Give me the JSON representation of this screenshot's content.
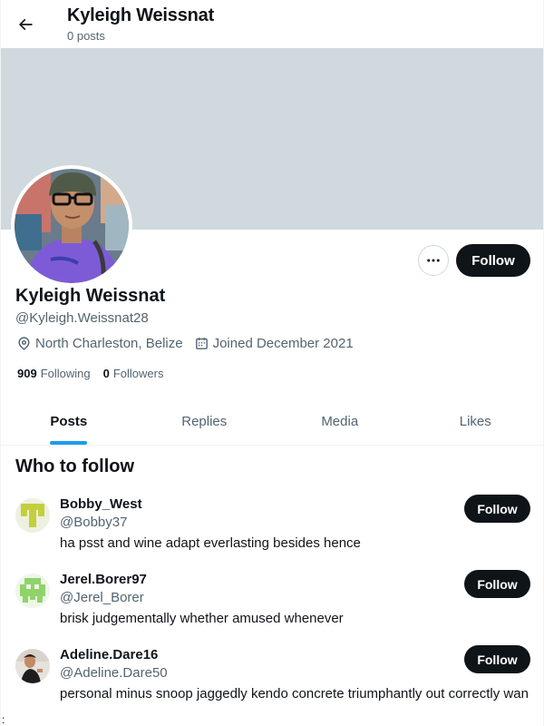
{
  "header": {
    "title": "Kyleigh Weissnat",
    "subtitle": "0 posts",
    "back_icon": "arrow-left-icon"
  },
  "profile": {
    "name": "Kyleigh Weissnat",
    "handle": "@Kyleigh.Weissnat28",
    "location": "North Charleston, Belize",
    "joined": "Joined December 2021",
    "following_count": "909",
    "following_label": "Following",
    "followers_count": "0",
    "followers_label": "Followers",
    "follow_label": "Follow",
    "banner_color": "#cfd9de"
  },
  "tabs": [
    {
      "label": "Posts",
      "active": true
    },
    {
      "label": "Replies",
      "active": false
    },
    {
      "label": "Media",
      "active": false
    },
    {
      "label": "Likes",
      "active": false
    }
  ],
  "who_to_follow": {
    "title": "Who to follow",
    "items": [
      {
        "name": "Bobby_West",
        "handle": "@Bobby37",
        "bio": "ha psst and wine adapt everlasting besides hence",
        "follow_label": "Follow"
      },
      {
        "name": "Jerel.Borer97",
        "handle": "@Jerel_Borer",
        "bio": "brisk judgementally whether amused whenever",
        "follow_label": "Follow"
      },
      {
        "name": "Adeline.Dare16",
        "handle": "@Adeline.Dare50",
        "bio": "personal minus snoop jaggedly kendo concrete triumphantly out correctly wan",
        "follow_label": "Follow"
      }
    ]
  },
  "stray_char": ":",
  "colors": {
    "accent": "#1d9bf0",
    "text_primary": "#0f1419",
    "text_secondary": "#536471",
    "button_dark": "#0f1419"
  }
}
